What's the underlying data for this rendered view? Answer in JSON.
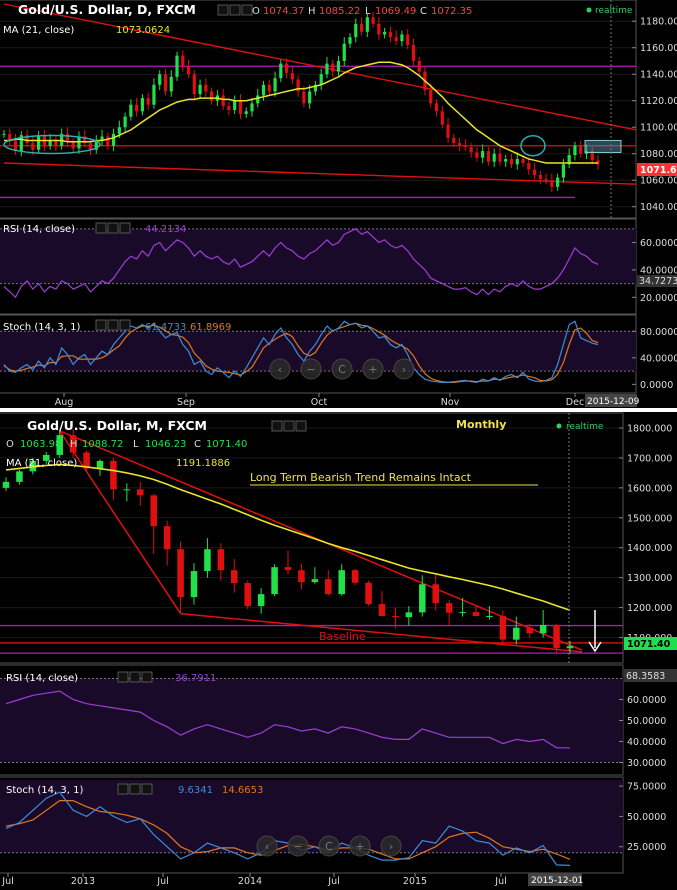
{
  "colors": {
    "bg": "#000000",
    "up": "#22e04a",
    "down": "#e01010",
    "ma": "#e7e42a",
    "rsi": "#9b3fd6",
    "stochK": "#3b8ddb",
    "stochD": "#e0761c",
    "trend": "#e01010",
    "level": "#b01cb0",
    "price_badge": "#ff3030",
    "price_badge_monthly": "#1ee04a",
    "title_text": "#ffffff",
    "annotation": "#f0e14a",
    "realtime": "#33cc66"
  },
  "daily": {
    "title": "Gold/U.S. Dollar, D, FXCM",
    "ohlc": {
      "o": "O",
      "o_val": "1074.37",
      "h": "H",
      "h_val": "1085.22",
      "l": "L",
      "l_val": "1069.49",
      "c": "C",
      "c_val": "1072.35"
    },
    "realtime": "realtime",
    "ma_label": "MA (21, close)",
    "ma_value": "1073.0624",
    "price_badge": "1071.61",
    "rsi_label": "RSI (14, close)",
    "rsi_value": "44.2134",
    "rsi_badge": "34.7273",
    "stoch_label": "Stoch (14, 3, 1)",
    "stoch_k_value": "61.4733",
    "stoch_d_value": "61.8969",
    "date_badge": "2015-12-09"
  },
  "monthly": {
    "title": "Gold/U.S. Dollar, M, FXCM",
    "period_label": "Monthly",
    "ohlc": {
      "o": "O",
      "o_val": "1063.98",
      "h": "H",
      "h_val": "1088.72",
      "l": "L",
      "l_val": "1046.23",
      "c": "C",
      "c_val": "1071.40"
    },
    "realtime": "realtime",
    "ma_label": "MA (21, close)",
    "ma_value": "1191.1886",
    "annotation": "Long Term Bearish Trend Remains Intact",
    "baseline_label": "Baseline",
    "price_badge": "1071.40",
    "rsi_label": "RSI (14, close)",
    "rsi_value": "36.7911",
    "rsi_badge": "68.3583",
    "stoch_label": "Stoch (14, 3, 1)",
    "stoch_k_value": "9.6341",
    "stoch_d_value": "14.6653",
    "date_badge": "2015-12-01"
  },
  "nav_buttons": [
    "‹",
    "−",
    "C",
    "+",
    "›"
  ],
  "chart_data": [
    {
      "type": "candlestick",
      "title": "Gold/U.S. Dollar, D, FXCM",
      "x_tick_labels": [
        "Aug",
        "Sep",
        "Oct",
        "Nov",
        "Dec"
      ],
      "y_tick_labels": [
        "1040.00",
        "1060.00",
        "1080.00",
        "1100.00",
        "1120.00",
        "1140.00",
        "1160.00",
        "1180.00"
      ],
      "ylim": [
        1033,
        1193
      ],
      "closes": [
        1095,
        1090,
        1082,
        1094,
        1088,
        1083,
        1094,
        1086,
        1090,
        1086,
        1095,
        1089,
        1084,
        1093,
        1088,
        1083,
        1090,
        1093,
        1086,
        1095,
        1100,
        1108,
        1117,
        1112,
        1122,
        1117,
        1132,
        1140,
        1127,
        1138,
        1154,
        1146,
        1140,
        1125,
        1132,
        1127,
        1120,
        1124,
        1116,
        1113,
        1120,
        1110,
        1112,
        1118,
        1124,
        1132,
        1127,
        1137,
        1148,
        1141,
        1136,
        1127,
        1118,
        1127,
        1132,
        1140,
        1148,
        1142,
        1150,
        1163,
        1168,
        1178,
        1172,
        1183,
        1178,
        1170,
        1172,
        1168,
        1165,
        1170,
        1162,
        1150,
        1142,
        1128,
        1118,
        1112,
        1102,
        1092,
        1088,
        1086,
        1085,
        1081,
        1077,
        1082,
        1074,
        1080,
        1074,
        1076,
        1072,
        1076,
        1073,
        1068,
        1064,
        1061,
        1060,
        1055,
        1062,
        1072,
        1079,
        1086,
        1080,
        1082,
        1075,
        1072
      ],
      "ma21": {
        "label": "MA (21, close)",
        "values": [
          1090,
          1090,
          1091,
          1091,
          1090,
          1090,
          1090,
          1090,
          1090,
          1090,
          1090,
          1089,
          1089,
          1089,
          1089,
          1089,
          1090,
          1090,
          1091,
          1092,
          1094,
          1096,
          1098,
          1101,
          1104,
          1107,
          1110,
          1113,
          1115,
          1117,
          1119,
          1120,
          1121,
          1121,
          1122,
          1122,
          1122,
          1122,
          1121,
          1121,
          1120,
          1120,
          1120,
          1121,
          1122,
          1123,
          1124,
          1125,
          1126,
          1127,
          1128,
          1129,
          1129,
          1130,
          1131,
          1132,
          1134,
          1136,
          1138,
          1141,
          1143,
          1145,
          1146,
          1147,
          1148,
          1149,
          1149,
          1149,
          1148,
          1147,
          1145,
          1142,
          1139,
          1135,
          1131,
          1127,
          1123,
          1118,
          1114,
          1110,
          1106,
          1102,
          1098,
          1095,
          1092,
          1089,
          1086,
          1084,
          1082,
          1080,
          1078,
          1076,
          1075,
          1074,
          1073,
          1073,
          1073,
          1073,
          1073,
          1073,
          1073,
          1073,
          1073,
          1073
        ]
      },
      "levels": [
        1146,
        1086,
        1047
      ],
      "rsi": {
        "label": "RSI (14, close)",
        "ylim": [
          10,
          75
        ],
        "y_tick_labels": [
          "20.0000",
          "40.0000",
          "60.0000"
        ],
        "bands": [
          70,
          30
        ],
        "values": [
          28,
          24,
          20,
          28,
          32,
          26,
          30,
          24,
          28,
          26,
          32,
          30,
          26,
          28,
          30,
          24,
          28,
          32,
          30,
          34,
          40,
          46,
          50,
          48,
          54,
          50,
          58,
          60,
          54,
          58,
          62,
          60,
          56,
          50,
          54,
          50,
          48,
          50,
          46,
          44,
          48,
          42,
          44,
          46,
          50,
          54,
          50,
          56,
          60,
          56,
          54,
          50,
          48,
          52,
          54,
          58,
          62,
          58,
          60,
          66,
          68,
          70,
          66,
          68,
          64,
          60,
          62,
          58,
          56,
          58,
          54,
          48,
          44,
          40,
          34,
          32,
          30,
          28,
          26,
          26,
          27,
          24,
          22,
          26,
          22,
          26,
          24,
          28,
          30,
          28,
          32,
          28,
          26,
          26,
          28,
          30,
          34,
          40,
          48,
          56,
          52,
          50,
          46,
          44
        ]
      },
      "stoch": {
        "label": "Stoch (14, 3, 1)",
        "ylim": [
          -10,
          100
        ],
        "y_tick_labels": [
          "0.0000",
          "40.0000",
          "80.0000"
        ],
        "bands": [
          80,
          20
        ],
        "k": [
          30,
          20,
          18,
          25,
          30,
          22,
          35,
          25,
          40,
          30,
          55,
          45,
          30,
          40,
          45,
          30,
          40,
          50,
          45,
          60,
          70,
          80,
          88,
          85,
          90,
          85,
          92,
          80,
          70,
          75,
          78,
          60,
          50,
          30,
          35,
          20,
          15,
          25,
          18,
          10,
          20,
          12,
          25,
          40,
          55,
          70,
          60,
          75,
          85,
          70,
          60,
          45,
          35,
          50,
          60,
          75,
          88,
          80,
          85,
          95,
          90,
          92,
          85,
          88,
          80,
          70,
          72,
          60,
          55,
          60,
          45,
          25,
          15,
          8,
          5,
          4,
          3,
          3,
          4,
          5,
          6,
          4,
          3,
          8,
          5,
          10,
          6,
          12,
          15,
          10,
          18,
          8,
          5,
          4,
          6,
          10,
          30,
          60,
          90,
          95,
          70,
          66,
          62,
          60
        ],
        "d": [
          28,
          22,
          20,
          21,
          24,
          26,
          29,
          28,
          33,
          33,
          42,
          43,
          43,
          38,
          38,
          38,
          38,
          40,
          45,
          52,
          58,
          70,
          79,
          84,
          88,
          87,
          89,
          86,
          81,
          75,
          74,
          71,
          63,
          47,
          38,
          28,
          23,
          20,
          19,
          18,
          16,
          14,
          19,
          26,
          40,
          55,
          62,
          68,
          73,
          77,
          72,
          58,
          47,
          43,
          48,
          62,
          74,
          81,
          84,
          87,
          90,
          92,
          89,
          88,
          84,
          79,
          74,
          67,
          62,
          58,
          53,
          43,
          28,
          16,
          9,
          6,
          4,
          3,
          3,
          4,
          5,
          5,
          4,
          5,
          5,
          8,
          7,
          9,
          11,
          12,
          14,
          12,
          10,
          6,
          5,
          7,
          15,
          33,
          60,
          82,
          85,
          77,
          66,
          63
        ]
      }
    },
    {
      "type": "candlestick",
      "title": "Gold/U.S. Dollar, M, FXCM",
      "x_tick_labels": [
        "Jul",
        "2013",
        "Jul",
        "2014",
        "Jul",
        "2015",
        "Jul"
      ],
      "y_tick_labels": [
        "1100.000",
        "1200.000",
        "1300.000",
        "1400.000",
        "1500.000",
        "1600.000",
        "1700.000",
        "1800.000"
      ],
      "ylim": [
        1025,
        1840
      ],
      "candles": [
        [
          1600,
          1635,
          1590,
          1620
        ],
        [
          1620,
          1660,
          1610,
          1655
        ],
        [
          1655,
          1700,
          1645,
          1690
        ],
        [
          1690,
          1720,
          1680,
          1710
        ],
        [
          1710,
          1790,
          1700,
          1776
        ],
        [
          1776,
          1796,
          1700,
          1718
        ],
        [
          1718,
          1725,
          1655,
          1665
        ],
        [
          1665,
          1695,
          1640,
          1690
        ],
        [
          1690,
          1700,
          1560,
          1595
        ],
        [
          1595,
          1615,
          1555,
          1595
        ],
        [
          1595,
          1620,
          1540,
          1575
        ],
        [
          1575,
          1580,
          1380,
          1472
        ],
        [
          1472,
          1490,
          1340,
          1395
        ],
        [
          1395,
          1420,
          1180,
          1235
        ],
        [
          1235,
          1348,
          1210,
          1322
        ],
        [
          1322,
          1432,
          1300,
          1395
        ],
        [
          1395,
          1415,
          1290,
          1325
        ],
        [
          1325,
          1362,
          1250,
          1282
        ],
        [
          1282,
          1290,
          1195,
          1205
        ],
        [
          1205,
          1265,
          1180,
          1245
        ],
        [
          1245,
          1345,
          1238,
          1335
        ],
        [
          1335,
          1390,
          1310,
          1325
        ],
        [
          1325,
          1345,
          1260,
          1285
        ],
        [
          1285,
          1335,
          1280,
          1295
        ],
        [
          1295,
          1325,
          1240,
          1245
        ],
        [
          1245,
          1345,
          1240,
          1325
        ],
        [
          1325,
          1330,
          1275,
          1283
        ],
        [
          1283,
          1290,
          1205,
          1212
        ],
        [
          1212,
          1255,
          1180,
          1172
        ],
        [
          1172,
          1200,
          1130,
          1168
        ],
        [
          1168,
          1205,
          1140,
          1184
        ],
        [
          1184,
          1308,
          1170,
          1278
        ],
        [
          1278,
          1310,
          1190,
          1215
        ],
        [
          1215,
          1225,
          1142,
          1183
        ],
        [
          1183,
          1232,
          1170,
          1185
        ],
        [
          1185,
          1205,
          1170,
          1172
        ],
        [
          1172,
          1205,
          1160,
          1172
        ],
        [
          1172,
          1190,
          1080,
          1093
        ],
        [
          1093,
          1170,
          1077,
          1133
        ],
        [
          1133,
          1145,
          1100,
          1114
        ],
        [
          1114,
          1192,
          1100,
          1142
        ],
        [
          1142,
          1145,
          1050,
          1065
        ],
        [
          1063.98,
          1088.72,
          1046.23,
          1071.4
        ]
      ],
      "ma21": {
        "label": "MA (21, close)",
        "values": [
          1660,
          1665,
          1670,
          1675,
          1678,
          1675,
          1670,
          1664,
          1658,
          1650,
          1640,
          1628,
          1612,
          1594,
          1578,
          1562,
          1546,
          1528,
          1510,
          1492,
          1475,
          1460,
          1445,
          1430,
          1414,
          1400,
          1388,
          1374,
          1360,
          1346,
          1332,
          1322,
          1313,
          1303,
          1294,
          1284,
          1274,
          1262,
          1248,
          1235,
          1222,
          1206,
          1191
        ]
      },
      "levels": [
        1140,
        1082,
        1048
      ],
      "rsi": {
        "label": "RSI (14, close)",
        "ylim": [
          25,
          75
        ],
        "y_tick_labels": [
          "30.0000",
          "40.0000",
          "50.0000",
          "60.0000"
        ],
        "bands": [
          70,
          30
        ],
        "values": [
          58,
          60,
          62,
          63,
          64,
          60,
          58,
          57,
          56,
          55,
          54,
          50,
          47,
          43,
          46,
          48,
          46,
          44,
          42,
          44,
          48,
          47,
          45,
          46,
          44,
          47,
          46,
          44,
          42,
          41,
          41,
          46,
          44,
          42,
          42,
          42,
          42,
          39,
          41,
          40,
          41,
          37,
          37
        ]
      },
      "stoch": {
        "label": "Stoch (14, 3, 1)",
        "ylim": [
          5,
          80
        ],
        "y_tick_labels": [
          "25.0000",
          "50.0000",
          "75.0000"
        ],
        "bands": [
          80,
          20
        ],
        "k": [
          40,
          45,
          55,
          65,
          70,
          55,
          50,
          58,
          50,
          45,
          48,
          35,
          25,
          15,
          20,
          28,
          24,
          20,
          15,
          20,
          30,
          28,
          22,
          25,
          20,
          28,
          24,
          18,
          14,
          14,
          16,
          30,
          28,
          42,
          38,
          30,
          28,
          18,
          24,
          20,
          26,
          10,
          9.6341
        ],
        "d": [
          42,
          44,
          47,
          55,
          63,
          63,
          58,
          54,
          53,
          51,
          48,
          43,
          36,
          25,
          20,
          21,
          24,
          24,
          20,
          18,
          22,
          26,
          27,
          25,
          22,
          24,
          24,
          23,
          19,
          15,
          15,
          20,
          25,
          33,
          36,
          37,
          32,
          25,
          23,
          21,
          23,
          19,
          14.6653
        ]
      }
    }
  ]
}
